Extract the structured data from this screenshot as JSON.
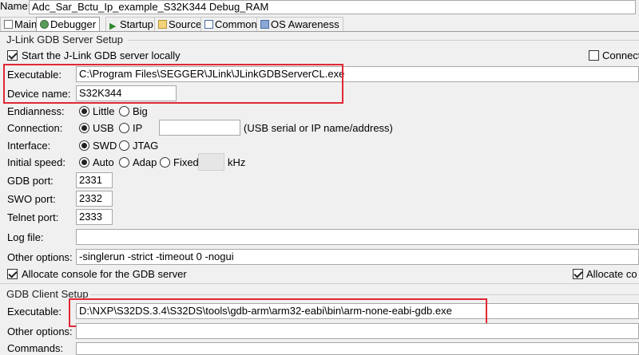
{
  "header": {
    "name_label": "Name:",
    "config_name": "Adc_Sar_Bctu_Ip_example_S32K344 Debug_RAM"
  },
  "tabs": [
    {
      "label": "Main",
      "icon": "main-tab-icon"
    },
    {
      "label": "Debugger",
      "icon": "debugger-tab-icon"
    },
    {
      "label": "Startup",
      "icon": "startup-tab-icon"
    },
    {
      "label": "Source",
      "icon": "source-tab-icon"
    },
    {
      "label": "Common",
      "icon": "common-tab-icon"
    },
    {
      "label": "OS Awareness",
      "icon": "os-awareness-tab-icon"
    }
  ],
  "server": {
    "group_title": "J-Link GDB Server Setup",
    "start_locally": {
      "label": "Start the J-Link GDB server locally",
      "checked": true
    },
    "connect_label": "Connect",
    "executable": {
      "label": "Executable:",
      "value": "C:\\Program Files\\SEGGER\\JLink\\JLinkGDBServerCL.exe"
    },
    "device_name": {
      "label": "Device name:",
      "value": "S32K344"
    },
    "endianness": {
      "label": "Endianness:",
      "options": [
        "Little",
        "Big"
      ],
      "selected": "Little"
    },
    "connection": {
      "label": "Connection:",
      "options": [
        "USB",
        "IP"
      ],
      "selected": "USB",
      "ip_value": "",
      "hint": "(USB serial or IP name/address)"
    },
    "interface": {
      "label": "Interface:",
      "options": [
        "SWD",
        "JTAG"
      ],
      "selected": "SWD"
    },
    "initial_speed": {
      "label": "Initial speed:",
      "options": [
        "Auto",
        "Adap",
        "Fixed"
      ],
      "selected": "Auto",
      "fixed_value": "",
      "unit": "kHz"
    },
    "gdb_port": {
      "label": "GDB port:",
      "value": "2331"
    },
    "swo_port": {
      "label": "SWO port:",
      "value": "2332"
    },
    "telnet_port": {
      "label": "Telnet port:",
      "value": "2333"
    },
    "log_file": {
      "label": "Log file:",
      "value": ""
    },
    "other_options": {
      "label": "Other options:",
      "value": "-singlerun -strict -timeout 0 -nogui"
    },
    "allocate_console": {
      "label": "Allocate console for the GDB server",
      "checked": true
    },
    "allocate_right": {
      "label": "Allocate co",
      "checked": true
    }
  },
  "client": {
    "group_title": "GDB Client Setup",
    "executable": {
      "label": "Executable:",
      "value": "D:\\NXP\\S32DS.3.4\\S32DS\\tools\\gdb-arm\\arm32-eabi\\bin\\arm-none-eabi-gdb.exe"
    },
    "other_options": {
      "label": "Other options:",
      "value": ""
    },
    "commands_label": "Commands:"
  },
  "colors": {
    "highlight": "#e02835",
    "background": "#f0f0f0",
    "field_border": "#a8a8a8"
  }
}
